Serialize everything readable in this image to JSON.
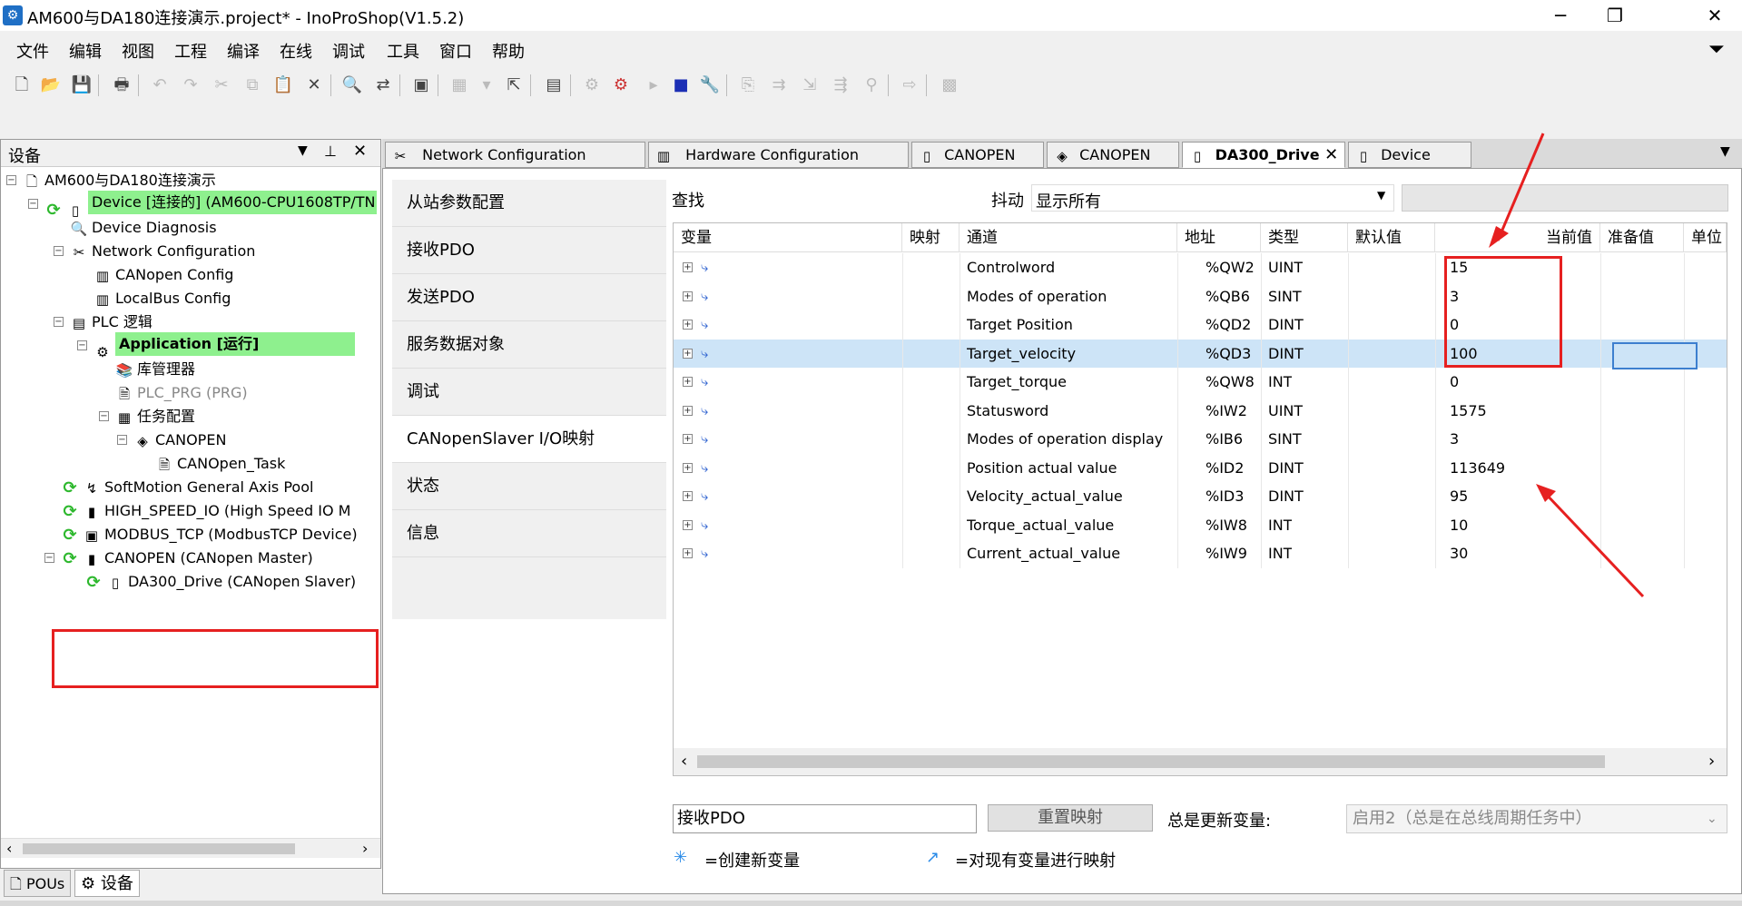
{
  "window": {
    "title": "AM600与DA180连接演示.project* - InoProShop(V1.5.2)",
    "minimize_glyph": "─",
    "maximize_glyph": "❐",
    "close_glyph": "✕"
  },
  "menu": [
    "文件",
    "编辑",
    "视图",
    "工程",
    "编译",
    "在线",
    "调试",
    "工具",
    "窗口",
    "帮助"
  ],
  "left_panel": {
    "title": "设备",
    "tree": [
      {
        "label": "AM600与DA180连接演示",
        "level": 0,
        "icon": "project-icon",
        "expander": "⊟"
      },
      {
        "label": "Device [连接的] (AM600-CPU1608TP/TN",
        "level": 1,
        "icon": "device-icon",
        "sync": true,
        "highlight": true,
        "expander": "⊟"
      },
      {
        "label": "Device Diagnosis",
        "level": 2,
        "icon": "diagnosis-icon"
      },
      {
        "label": "Network Configuration",
        "level": 2,
        "icon": "network-config-icon",
        "expander": "⊟"
      },
      {
        "label": "CANopen Config",
        "level": 3,
        "icon": "canopen-config-icon"
      },
      {
        "label": "LocalBus Config",
        "level": 3,
        "icon": "localbus-config-icon"
      },
      {
        "label": "PLC 逻辑",
        "level": 2,
        "icon": "plc-logic-icon",
        "expander": "⊟"
      },
      {
        "label": "Application [运行]",
        "level": 3,
        "icon": "application-icon",
        "bold": true,
        "highlight": true,
        "expander": "⊟"
      },
      {
        "label": "库管理器",
        "level": 4,
        "icon": "library-icon"
      },
      {
        "label": "PLC_PRG (PRG)",
        "level": 4,
        "icon": "prg-icon",
        "grey": true
      },
      {
        "label": "任务配置",
        "level": 4,
        "icon": "task-config-icon",
        "expander": "⊟"
      },
      {
        "label": "CANOPEN",
        "level": 5,
        "icon": "canopen-task-icon",
        "expander": "⊟"
      },
      {
        "label": "CANOpen_Task",
        "level": 6,
        "icon": "task-icon"
      },
      {
        "label": "SoftMotion General Axis Pool",
        "level": 2,
        "icon": "axis-pool-icon",
        "sync": true
      },
      {
        "label": "HIGH_SPEED_IO (High Speed IO M",
        "level": 2,
        "icon": "io-module-icon",
        "sync": true
      },
      {
        "label": "MODBUS_TCP (ModbusTCP Device)",
        "level": 2,
        "icon": "modbus-icon",
        "sync": true
      },
      {
        "label": "CANOPEN (CANopen Master)",
        "level": 2,
        "icon": "canopen-master-icon",
        "sync": true,
        "expander": "⊟"
      },
      {
        "label": "DA300_Drive (CANopen Slaver)",
        "level": 3,
        "icon": "canopen-slave-icon",
        "sync": true
      }
    ],
    "bottom_tabs": [
      "POUs",
      "设备"
    ]
  },
  "doc_tabs": [
    {
      "label": "Network Configuration"
    },
    {
      "label": "Hardware Configuration"
    },
    {
      "label": "CANOPEN"
    },
    {
      "label": "CANOPEN"
    },
    {
      "label": "DA300_Drive",
      "active": true
    },
    {
      "label": "Device"
    }
  ],
  "side_nav": [
    "从站参数配置",
    "接收PDO",
    "发送PDO",
    "服务数据对象",
    "调试",
    "CANopenSlaver I/O映射",
    "状态",
    "信息"
  ],
  "filter": {
    "find_label": "查找",
    "filter_label": "抖动",
    "filter_value": "显示所有"
  },
  "grid": {
    "columns": [
      "变量",
      "映射",
      "通道",
      "地址",
      "类型",
      "默认值",
      "当前值",
      "准备值",
      "单位"
    ],
    "rows": [
      {
        "channel": "Controlword",
        "address": "%QW2",
        "type": "UINT",
        "current": "15"
      },
      {
        "channel": "Modes of operation",
        "address": "%QB6",
        "type": "SINT",
        "current": "3"
      },
      {
        "channel": "Target Position",
        "address": "%QD2",
        "type": "DINT",
        "current": "0"
      },
      {
        "channel": "Target_velocity",
        "address": "%QD3",
        "type": "DINT",
        "current": "100",
        "selected": true
      },
      {
        "channel": "Target_torque",
        "address": "%QW8",
        "type": "INT",
        "current": "0"
      },
      {
        "channel": "Statusword",
        "address": "%IW2",
        "type": "UINT",
        "current": "1575"
      },
      {
        "channel": "Modes of operation display",
        "address": "%IB6",
        "type": "SINT",
        "current": "3"
      },
      {
        "channel": "Position actual value",
        "address": "%ID2",
        "type": "DINT",
        "current": "113649"
      },
      {
        "channel": "Velocity_actual_value",
        "address": "%ID3",
        "type": "DINT",
        "current": "95"
      },
      {
        "channel": "Torque_actual_value",
        "address": "%IW8",
        "type": "INT",
        "current": "10"
      },
      {
        "channel": "Current_actual_value",
        "address": "%IW9",
        "type": "INT",
        "current": "30"
      }
    ]
  },
  "bottom": {
    "pdo_value": "接收PDO",
    "reset_button": "重置映射",
    "always_update_label": "总是更新变量:",
    "always_update_value": "启用2（总是在总线周期任务中）",
    "legend_new": "=创建新变量",
    "legend_map": "=对现有变量进行映射"
  },
  "colors": {
    "highlight_green": "#8ef08e",
    "selected_row": "#cde4f7",
    "annotation_red": "#e62020"
  }
}
